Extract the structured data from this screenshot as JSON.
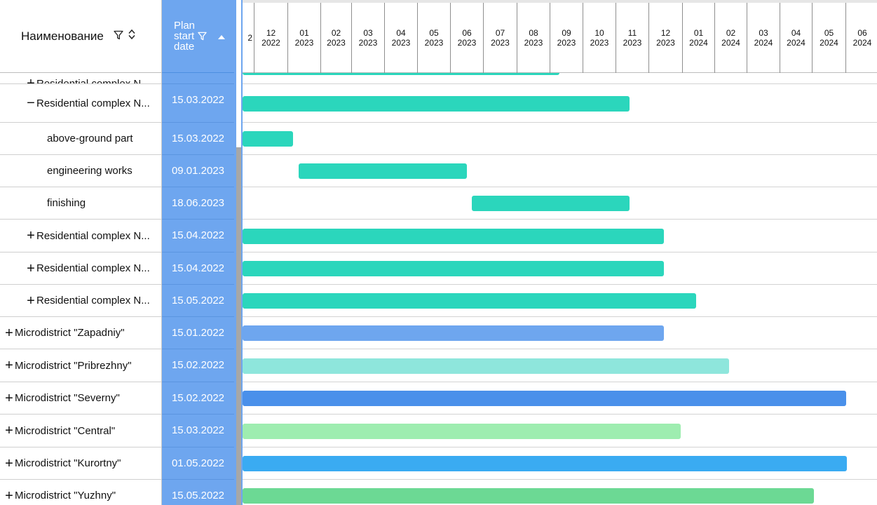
{
  "columns": {
    "name_header": "Наименование",
    "date_header_lines": [
      "Plan",
      "start",
      "date"
    ]
  },
  "months": [
    {
      "m": "12",
      "y": "2022"
    },
    {
      "m": "01",
      "y": "2023"
    },
    {
      "m": "02",
      "y": "2023"
    },
    {
      "m": "03",
      "y": "2023"
    },
    {
      "m": "04",
      "y": "2023"
    },
    {
      "m": "05",
      "y": "2023"
    },
    {
      "m": "06",
      "y": "2023"
    },
    {
      "m": "07",
      "y": "2023"
    },
    {
      "m": "08",
      "y": "2023"
    },
    {
      "m": "09",
      "y": "2023"
    },
    {
      "m": "10",
      "y": "2023"
    },
    {
      "m": "11",
      "y": "2023"
    },
    {
      "m": "12",
      "y": "2023"
    },
    {
      "m": "01",
      "y": "2024"
    },
    {
      "m": "02",
      "y": "2024"
    },
    {
      "m": "03",
      "y": "2024"
    },
    {
      "m": "04",
      "y": "2024"
    },
    {
      "m": "05",
      "y": "2024"
    },
    {
      "m": "06",
      "y": "2024"
    }
  ],
  "partial_month_label": "2",
  "rows": [
    {
      "name": "Residential complex N...",
      "expander": "+",
      "level": 2,
      "date": "",
      "bar_color": "#2bd6bc"
    },
    {
      "name": "Residential complex N...",
      "expander": "−",
      "level": 2,
      "date": "15.03.2022",
      "bar_color": "#2bd6bc"
    },
    {
      "name": "above-ground part",
      "expander": "",
      "level": 3,
      "date": "15.03.2022",
      "bar_color": "#2bd6bc"
    },
    {
      "name": "engineering works",
      "expander": "",
      "level": 3,
      "date": "09.01.2023",
      "bar_color": "#2bd6bc"
    },
    {
      "name": "finishing",
      "expander": "",
      "level": 3,
      "date": "18.06.2023",
      "bar_color": "#2bd6bc"
    },
    {
      "name": "Residential complex N...",
      "expander": "+",
      "level": 2,
      "date": "15.04.2022",
      "bar_color": "#2bd6bc"
    },
    {
      "name": "Residential complex N...",
      "expander": "+",
      "level": 2,
      "date": "15.04.2022",
      "bar_color": "#2bd6bc"
    },
    {
      "name": "Residential complex N...",
      "expander": "+",
      "level": 2,
      "date": "15.05.2022",
      "bar_color": "#2bd6bc"
    },
    {
      "name": "Microdistrict \"Zapadniy\"",
      "expander": "+",
      "level": 1,
      "date": "15.01.2022",
      "bar_color": "#6ea6ef"
    },
    {
      "name": "Microdistrict \"Pribrezhny\"",
      "expander": "+",
      "level": 1,
      "date": "15.02.2022",
      "bar_color": "#8ee6dc"
    },
    {
      "name": "Microdistrict \"Severny\"",
      "expander": "+",
      "level": 1,
      "date": "15.02.2022",
      "bar_color": "#4a90ea"
    },
    {
      "name": "Microdistrict \"Central\"",
      "expander": "+",
      "level": 1,
      "date": "15.03.2022",
      "bar_color": "#9eedb0"
    },
    {
      "name": "Microdistrict \"Kurortny\"",
      "expander": "+",
      "level": 1,
      "date": "01.05.2022",
      "bar_color": "#3aabf2"
    },
    {
      "name": "Microdistrict \"Yuzhny\"",
      "expander": "+",
      "level": 1,
      "date": "15.05.2022",
      "bar_color": "#6cd994"
    }
  ],
  "icons": {
    "filter": "filter-icon",
    "sort": "sort-icon",
    "expand": "plus-icon",
    "collapse": "minus-icon"
  }
}
